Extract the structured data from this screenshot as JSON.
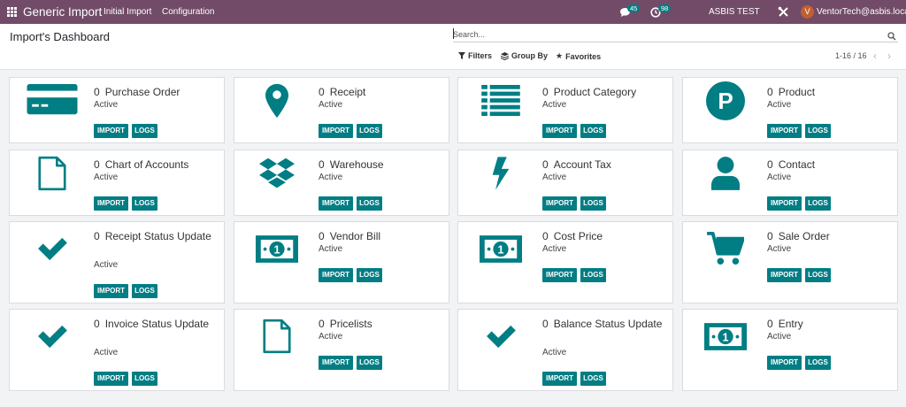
{
  "nav": {
    "brand": "Generic Import",
    "menu": [
      "Initial Import",
      "Configuration"
    ],
    "chat_count": "45",
    "activity_count": "98",
    "company": "ASBIS TEST",
    "user_initial": "V",
    "user": "VentorTech@asbis.local"
  },
  "control": {
    "title": "Import's Dashboard",
    "search_placeholder": "Search...",
    "filters": "Filters",
    "group_by": "Group By",
    "favorites": "Favorites",
    "pager": "1-16 / 16"
  },
  "buttons": {
    "import": "IMPORT",
    "logs": "LOGS"
  },
  "cards": [
    {
      "count": "0",
      "name": "Purchase Order",
      "status": "Active",
      "icon": "credit-card-icon"
    },
    {
      "count": "0",
      "name": "Receipt",
      "status": "Active",
      "icon": "map-marker-icon"
    },
    {
      "count": "0",
      "name": "Product Category",
      "status": "Active",
      "icon": "list-icon"
    },
    {
      "count": "0",
      "name": "Product",
      "status": "Active",
      "icon": "parking-icon"
    },
    {
      "count": "0",
      "name": "Chart of Accounts",
      "status": "Active",
      "icon": "file-icon"
    },
    {
      "count": "0",
      "name": "Warehouse",
      "status": "Active",
      "icon": "dropbox-icon"
    },
    {
      "count": "0",
      "name": "Account Tax",
      "status": "Active",
      "icon": "bolt-icon"
    },
    {
      "count": "0",
      "name": "Contact",
      "status": "Active",
      "icon": "user-icon"
    },
    {
      "count": "0",
      "name": "Receipt Status Update",
      "status": "Active",
      "icon": "check-icon"
    },
    {
      "count": "0",
      "name": "Vendor Bill",
      "status": "Active",
      "icon": "money-icon"
    },
    {
      "count": "0",
      "name": "Cost Price",
      "status": "Active",
      "icon": "money-icon"
    },
    {
      "count": "0",
      "name": "Sale Order",
      "status": "Active",
      "icon": "shopping-cart-icon"
    },
    {
      "count": "0",
      "name": "Invoice Status Update",
      "status": "Active",
      "icon": "check-icon"
    },
    {
      "count": "0",
      "name": "Pricelists",
      "status": "Active",
      "icon": "file-icon"
    },
    {
      "count": "0",
      "name": "Balance Status Update",
      "status": "Active",
      "icon": "check-icon"
    },
    {
      "count": "0",
      "name": "Entry",
      "status": "Active",
      "icon": "money-icon"
    }
  ]
}
